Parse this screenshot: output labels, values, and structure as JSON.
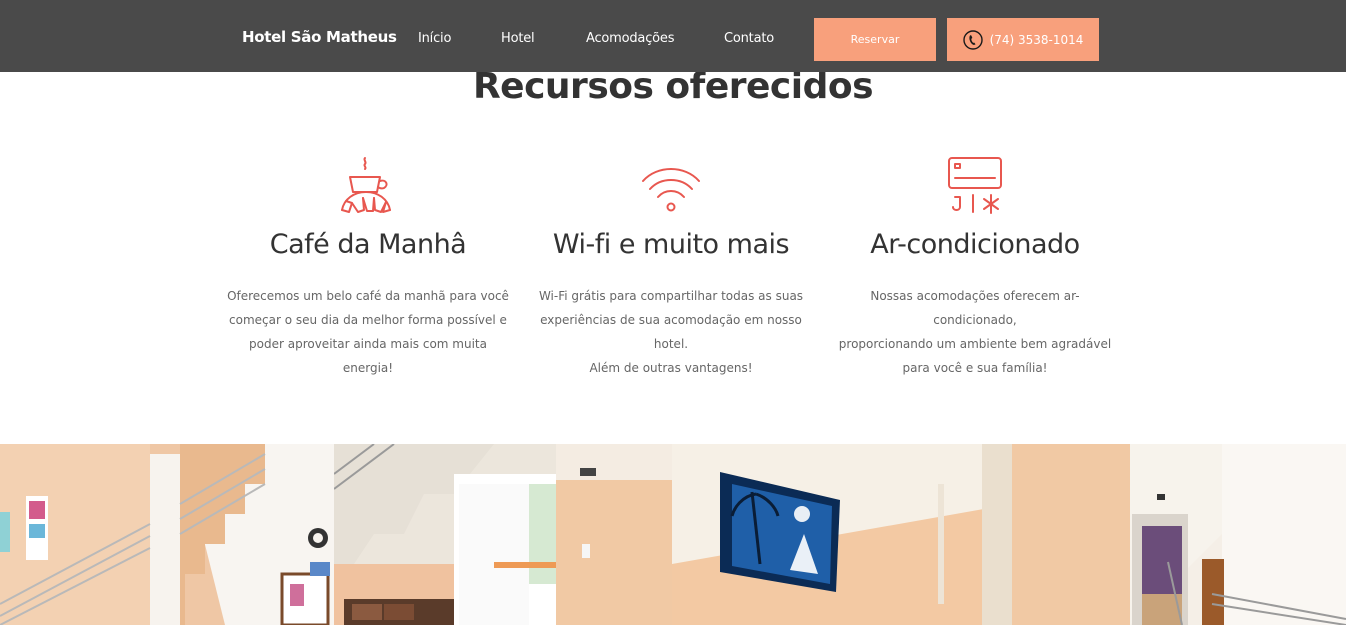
{
  "nav": {
    "brand": "Hotel São Matheus",
    "links": [
      "Início",
      "Hotel",
      "Acomodações",
      "Contato"
    ],
    "reserve_label": "Reservar",
    "phone": "(74) 3538-1014"
  },
  "section": {
    "title": "Recursos oferecidos",
    "features": [
      {
        "icon": "coffee-croissant-icon",
        "title": "Café da Manhâ",
        "lines": [
          "Oferecemos um belo café da manhã para você",
          "começar o seu dia da melhor forma possível e",
          "poder aproveitar ainda mais com muita energia!"
        ]
      },
      {
        "icon": "wifi-icon",
        "title": "Wi-fi e muito mais",
        "lines": [
          "Wi-Fi grátis para compartilhar todas as suas",
          "experiências de sua acomodação em nosso hotel.",
          "Além de outras vantagens!"
        ]
      },
      {
        "icon": "air-conditioner-icon",
        "title": "Ar-condicionado",
        "lines": [
          "Nossas acomodações oferecem ar-condicionado,",
          "proporcionando um ambiente bem agradável",
          "para você e sua família!"
        ]
      }
    ]
  },
  "colors": {
    "navbar": "#4a4a4a",
    "accent": "#f8a07c",
    "icon": "#e8574f",
    "text": "#333333",
    "muted": "#666666"
  }
}
